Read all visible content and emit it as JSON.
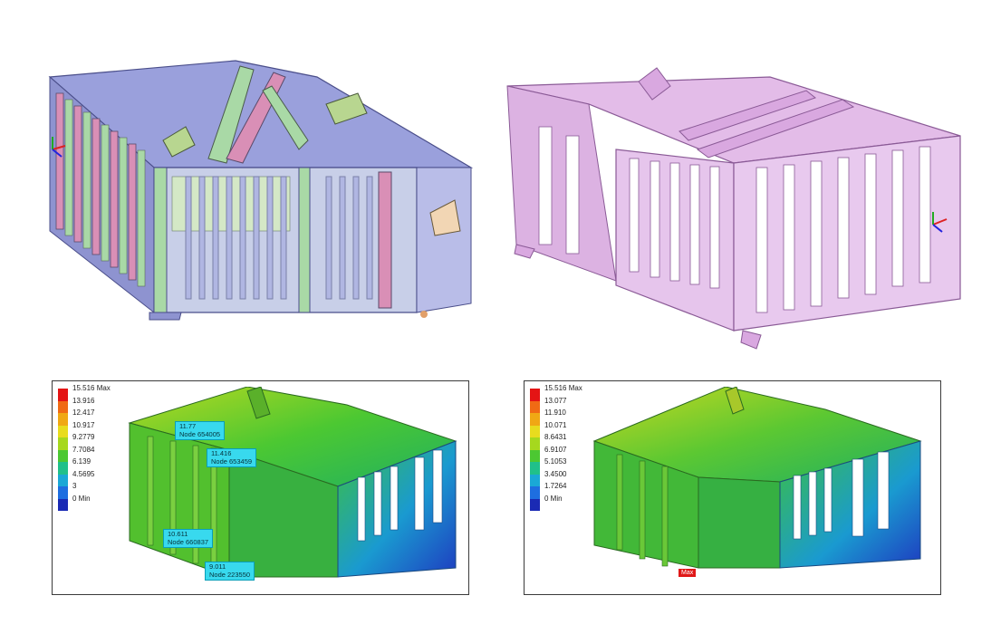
{
  "fea_left": {
    "legend": [
      {
        "label": "15.516 Max",
        "color": "#e41414"
      },
      {
        "label": "13.916",
        "color": "#f06a14"
      },
      {
        "label": "12.417",
        "color": "#f0a814"
      },
      {
        "label": "10.917",
        "color": "#e8dc1e"
      },
      {
        "label": "9.2779",
        "color": "#a6d81e"
      },
      {
        "label": "7.7084",
        "color": "#4cc832"
      },
      {
        "label": "6.139",
        "color": "#20c08a"
      },
      {
        "label": "4.5695",
        "color": "#1aa8d6"
      },
      {
        "label": "3",
        "color": "#1e6ee0"
      },
      {
        "label": "0 Min",
        "color": "#1a2ab4"
      }
    ],
    "callouts": [
      {
        "line1": "11.77",
        "line2": "Node 654005"
      },
      {
        "line1": "11.416",
        "line2": "Node 653459"
      },
      {
        "line1": "10.611",
        "line2": "Node 660837"
      },
      {
        "line1": "9.011",
        "line2": "Node 223550"
      }
    ]
  },
  "fea_right": {
    "legend": [
      {
        "label": "15.516 Max",
        "color": "#e41414"
      },
      {
        "label": "13.077",
        "color": "#f06a14"
      },
      {
        "label": "11.910",
        "color": "#f0a814"
      },
      {
        "label": "10.071",
        "color": "#e8dc1e"
      },
      {
        "label": "8.6431",
        "color": "#a6d81e"
      },
      {
        "label": "6.9107",
        "color": "#4cc832"
      },
      {
        "label": "5.1053",
        "color": "#20c08a"
      },
      {
        "label": "3.4500",
        "color": "#1aa8d6"
      },
      {
        "label": "1.7264",
        "color": "#1e6ee0"
      },
      {
        "label": "0 Min",
        "color": "#1a2ab4"
      }
    ],
    "max_tag": "Max"
  }
}
